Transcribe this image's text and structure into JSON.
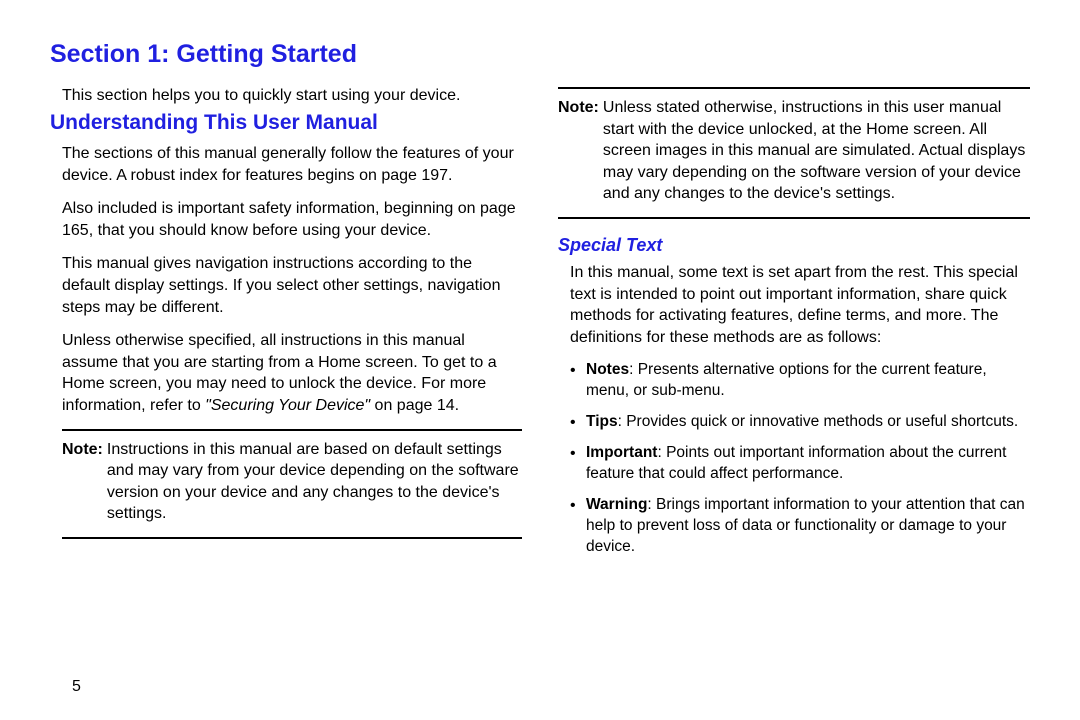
{
  "section_title": "Section 1: Getting Started",
  "intro": "This section helps you to quickly start using your device.",
  "subsection_title": "Understanding This User Manual",
  "left": {
    "p1": "The sections of this manual generally follow the features of your device. A robust index for features begins on page 197.",
    "p2": "Also included is important safety information, beginning on page 165, that you should know before using your device.",
    "p3": "This manual gives navigation instructions according to the default display settings. If you select other settings, navigation steps may be different.",
    "p4_a": "Unless otherwise specified, all instructions in this manual assume that you are starting from a Home screen. To get to a Home screen, you may need to unlock the device. For more information, refer to ",
    "p4_ref": "\"Securing Your Device\"",
    "p4_b": " on page 14.",
    "note_label": "Note:",
    "note_text": "Instructions in this manual are based on default settings and may vary from your device depending on the software version on your device and any changes to the device's settings."
  },
  "right": {
    "note_label": "Note:",
    "note_text": "Unless stated otherwise, instructions in this user manual start with the device unlocked, at the Home screen. All screen images in this manual are simulated. Actual displays may vary depending on the software version of your device and any changes to the device's settings.",
    "h3": "Special Text",
    "intro": "In this manual, some text is set apart from the rest. This special text is intended to point out important information, share quick methods for activating features, define terms, and more. The definitions for these methods are as follows:",
    "bullets": {
      "b1_label": "Notes",
      "b1_text": ": Presents alternative options for the current feature, menu, or sub-menu.",
      "b2_label": "Tips",
      "b2_text": ": Provides quick or innovative methods or useful shortcuts.",
      "b3_label": "Important",
      "b3_text": ": Points out important information about the current feature that could affect performance.",
      "b4_label": "Warning",
      "b4_text": ": Brings important information to your attention that can help to prevent loss of data or functionality or damage to your device."
    }
  },
  "page_number": "5"
}
